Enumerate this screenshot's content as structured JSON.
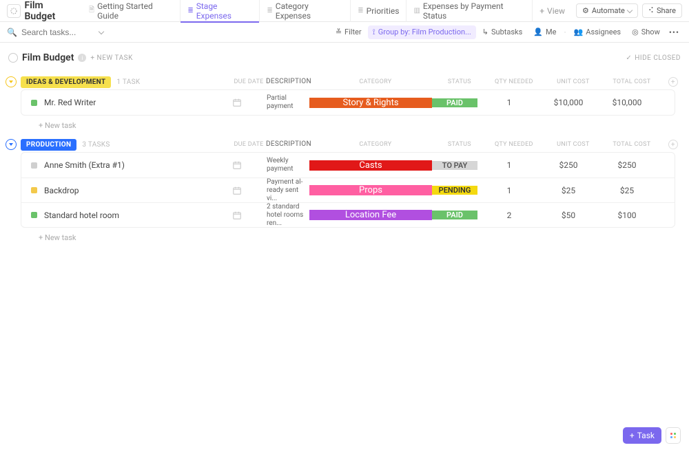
{
  "header": {
    "app_title": "Film Budget",
    "tabs": [
      {
        "label": "Getting Started Guide",
        "icon": "doc"
      },
      {
        "label": "Stage Expenses",
        "icon": "list",
        "active": true
      },
      {
        "label": "Category Expenses",
        "icon": "list"
      },
      {
        "label": "Priorities",
        "icon": "list"
      },
      {
        "label": "Expenses by Payment Status",
        "icon": "board"
      }
    ],
    "add_view_label": "View",
    "automate_label": "Automate",
    "share_label": "Share"
  },
  "toolbar": {
    "search_placeholder": "Search tasks...",
    "filter_label": "Filter",
    "group_label": "Group by: Film Production...",
    "subtasks_label": "Subtasks",
    "me_label": "Me",
    "assignees_label": "Assignees",
    "show_label": "Show"
  },
  "list": {
    "title": "Film Budget",
    "new_task_label": "+ NEW TASK",
    "hide_closed_label": "HIDE CLOSED"
  },
  "columns": {
    "due": "DUE DATE",
    "desc": "DESCRIPTION",
    "cat": "CATEGORY",
    "stat": "STATUS",
    "qty": "QTY NEEDED",
    "unit": "UNIT COST",
    "total": "TOTAL COST"
  },
  "groups": [
    {
      "id": "ideas",
      "label": "IDEAS & DEVELOPMENT",
      "color": "yellow",
      "count_label": "1 TASK",
      "tasks": [
        {
          "name": "Mr. Red Writer",
          "status_color": "#6ac26a",
          "description": "Partial payment",
          "category": {
            "label": "Story & Rights",
            "bg": "#e65c1e"
          },
          "status": {
            "label": "PAID",
            "bg": "#6ac26a",
            "fg": "#fff"
          },
          "qty": "1",
          "unit": "$10,000",
          "total": "$10,000"
        }
      ]
    },
    {
      "id": "production",
      "label": "PRODUCTION",
      "color": "blue",
      "count_label": "3 TASKS",
      "tasks": [
        {
          "name": "Anne Smith (Extra #1)",
          "status_color": "#cfcfcf",
          "description": "Weekly payment",
          "category": {
            "label": "Casts",
            "bg": "#e11818"
          },
          "status": {
            "label": "TO PAY",
            "bg": "#d6d6d6",
            "fg": "#555"
          },
          "qty": "1",
          "unit": "$250",
          "total": "$250"
        },
        {
          "name": "Backdrop",
          "status_color": "#f3c94b",
          "description": "Payment al­ready sent vi...",
          "category": {
            "label": "Props",
            "bg": "#ff5fa2"
          },
          "status": {
            "label": "PENDING",
            "bg": "#f4d90f",
            "fg": "#333"
          },
          "qty": "1",
          "unit": "$25",
          "total": "$25"
        },
        {
          "name": "Standard hotel room",
          "status_color": "#6ac26a",
          "description": "2 standard ho­tel rooms ren...",
          "category": {
            "label": "Location Fee",
            "bg": "#b14fe0"
          },
          "status": {
            "label": "PAID",
            "bg": "#6ac26a",
            "fg": "#fff"
          },
          "qty": "2",
          "unit": "$50",
          "total": "$100"
        }
      ]
    }
  ],
  "new_task_row_label": "+ New task",
  "float_task_label": "Task"
}
